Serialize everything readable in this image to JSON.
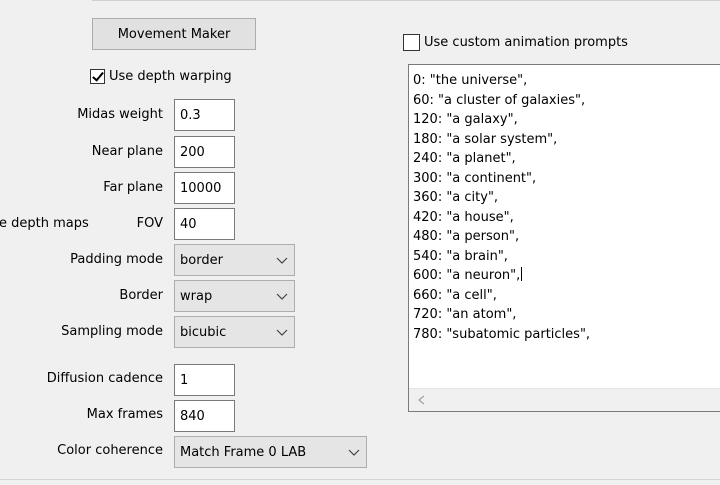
{
  "movement_maker_button": "Movement Maker",
  "use_depth_warping": {
    "label": "Use depth warping",
    "checked": true
  },
  "use_custom_prompts": {
    "label": "Use custom animation prompts",
    "checked": false
  },
  "fields": {
    "midas_weight": {
      "label": "Midas weight",
      "value": "0.3"
    },
    "near_plane": {
      "label": "Near plane",
      "value": "200"
    },
    "far_plane": {
      "label": "Far plane",
      "value": "10000"
    },
    "truncated_save_label": "e depth maps",
    "fov": {
      "label": "FOV",
      "value": "40"
    },
    "padding_mode": {
      "label": "Padding mode",
      "value": "border"
    },
    "border": {
      "label": "Border",
      "value": "wrap"
    },
    "sampling_mode": {
      "label": "Sampling mode",
      "value": "bicubic"
    },
    "diffusion_cadence": {
      "label": "Diffusion cadence",
      "value": "1"
    },
    "max_frames": {
      "label": "Max frames",
      "value": "840"
    },
    "color_coherence": {
      "label": "Color coherence",
      "value": "Match Frame 0 LAB"
    }
  },
  "prompts": [
    "0: \"the universe\",",
    "60: \"a cluster of galaxies\",",
    "120: \"a galaxy\",",
    "180: \"a solar system\",",
    "240: \"a planet\",",
    "300: \"a continent\",",
    "360: \"a city\",",
    "420: \"a house\",",
    "480: \"a person\",",
    "540: \"a brain\",",
    "600: \"a neuron\",",
    "660: \"a cell\",",
    "720: \"an atom\",",
    "780: \"subatomic particles\","
  ],
  "icons": {
    "checkbox_check": "check-icon",
    "dropdown": "chevron-down-icon",
    "scroll_left": "scroll-left-arrow-icon"
  }
}
